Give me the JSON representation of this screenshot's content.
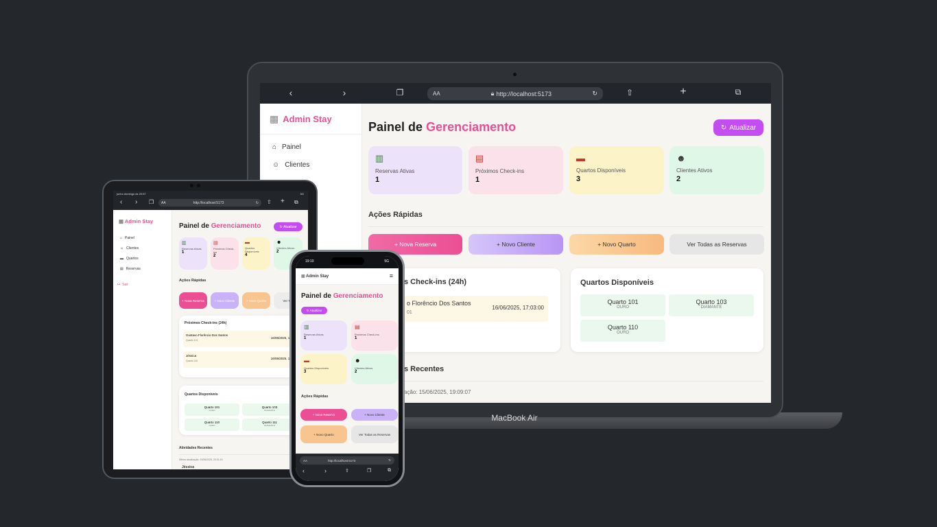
{
  "colors": {
    "accent": "#ec4e94",
    "update_button": "#c34df0",
    "background": "#24272c"
  },
  "brand": "Admin Stay",
  "laptop_label": "MacBook Air",
  "browser": {
    "aa": "AA",
    "url": "http://localhost:5173"
  },
  "nav": {
    "dashboard": "Painel",
    "clients": "Clientes",
    "rooms": "Quartos",
    "reservations": "Reservas",
    "logout": "Sair"
  },
  "header": {
    "title_plain": "Painel de",
    "title_accent": "Gerenciamento",
    "update_button": "Atualizar"
  },
  "stats": [
    {
      "icon": "chart-icon",
      "label": "Reservas Ativas",
      "value": "1"
    },
    {
      "icon": "calendar-icon",
      "label": "Próximos Check-ins",
      "value": "1"
    },
    {
      "icon": "bed-icon",
      "label": "Quartos Disponíveis",
      "value": "3"
    },
    {
      "icon": "users-icon",
      "label": "Clientes Ativos",
      "value": "2"
    }
  ],
  "tablet_stats": [
    {
      "label": "Reservas Ativas",
      "value": "1"
    },
    {
      "label": "Próximos Check-ins",
      "value": "2"
    },
    {
      "label": "Quartos Disponíveis",
      "value": "4"
    },
    {
      "label": "Clientes Ativos",
      "value": "2"
    }
  ],
  "quick_actions": {
    "title": "Ações Rápidas",
    "new_reservation": "+ Nova Reserva",
    "new_client": "+ Novo Cliente",
    "new_room": "+ Novo Quarto",
    "all_reservations": "Ver Todas as Reservas"
  },
  "laptop_checkins": {
    "title": "Próximos Check-ins (24h)",
    "visible_title": "s Check-ins (24h)",
    "name": "Gustavo Florêncio Dos Santos",
    "visible_name": "o Florêncio Dos Santos",
    "date": "16/06/2025, 17:03:00",
    "room": "Quarto 101",
    "visible_room": "01"
  },
  "tablet_checkins": {
    "title": "Próximos Check-ins (24h)",
    "items": [
      {
        "name": "Gustavo Florêncio Dos Santos",
        "room": "Quarto 101",
        "date": "16/06/2025, 17:03"
      },
      {
        "name": "Jéssica",
        "room": "Quarto 110",
        "date": "16/06/2025, 19:57"
      }
    ]
  },
  "rooms": {
    "title": "Quartos Disponíveis",
    "items": [
      {
        "name": "Quarto 101",
        "tier": "OURO"
      },
      {
        "name": "Quarto 103",
        "tier": "DIAMANTE"
      },
      {
        "name": "Quarto 110",
        "tier": "OURO"
      },
      {
        "name": "Quarto 111",
        "tier": "DIAMANTE"
      }
    ]
  },
  "recent": {
    "title": "Atividades Recentes",
    "visible_title": "s Recentes",
    "laptop_update": "ação: 15/06/2025, 19:09:07",
    "tablet_update": "Última atualização: 15/06/2025, 20:01:15",
    "tablet_item": "Jéssica"
  },
  "tablet_status": {
    "time": "junho domingo às 20:57",
    "signal": "5G"
  },
  "phone_status": {
    "time": "19:10",
    "signal": "5G"
  },
  "tablet_quick": {
    "new_reservation": "+ Nova Reserva",
    "new_client": "+ Novo Cliente",
    "new_room": "+ Novo Quarto",
    "all": "Ver Tod"
  }
}
